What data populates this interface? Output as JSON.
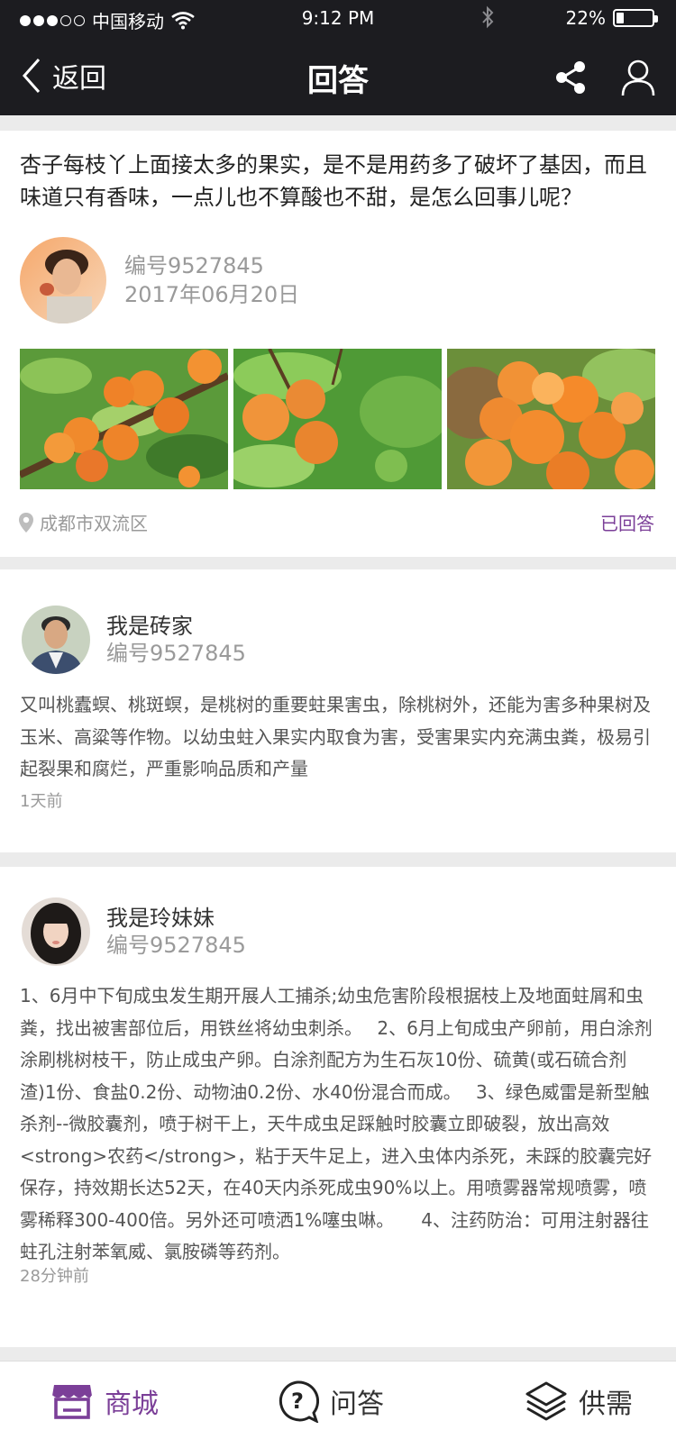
{
  "status": {
    "carrier": "中国移动",
    "time": "9:12 PM",
    "battery": "22%",
    "battery_level": 0.22,
    "signal_bars": 3
  },
  "nav": {
    "back_label": "返回",
    "title": "回答"
  },
  "question": {
    "text": "杏子每枝丫上面接太多的果实，是不是用药多了破坏了基因，而且味道只有香味，一点儿也不算酸也不甜，是怎么回事儿呢？",
    "user_code": "编号9527845",
    "date": "2017年06月20日",
    "location": "成都市双流区",
    "status": "已回答"
  },
  "answers": [
    {
      "name": "我是砖家",
      "code": "编号9527845",
      "body": "又叫桃蠹螟、桃斑螟，是桃树的重要蛀果害虫，除桃树外，还能为害多种果树及玉米、高粱等作物。以幼虫蛀入果实内取食为害，受害果实内充满虫粪，极易引起裂果和腐烂，严重影响品质和产量",
      "time": "1天前"
    },
    {
      "name": "我是玲妹妹",
      "code": "编号9527845",
      "body": "1、6月中下旬成虫发生期开展人工捕杀;幼虫危害阶段根据枝上及地面蛀屑和虫粪，找出被害部位后，用铁丝将幼虫刺杀。　 2、6月上旬成虫产卵前，用白涂剂涂刷桃树枝干，防止成虫产卵。白涂剂配方为生石灰10份、硫黄(或石硫合剂渣)1份、食盐0.2份、动物油0.2份、水40份混合而成。　 3、绿色威雷是新型触杀剂--微胶囊剂，喷于树干上，天牛成虫足踩触时胶囊立即破裂，放出高效<strong>农药</strong>，粘于天牛足上，进入虫体内杀死，未踩的胶囊完好保存，持效期长达52天，在40天内杀死成虫90%以上。用喷雾器常规喷雾，喷雾稀释300-400倍。另外还可喷洒1%噻虫啉。　　4、注药防治：可用注射器往蛀孔注射苯氧威、氯胺磷等药剂。",
      "time": "28分钟前"
    }
  ],
  "tabs": [
    {
      "label": "商城"
    },
    {
      "label": "问答"
    },
    {
      "label": "供需"
    }
  ],
  "colors": {
    "header_bg": "#1c1c20",
    "accent": "#7b3f98",
    "muted": "#9a9a9a"
  }
}
